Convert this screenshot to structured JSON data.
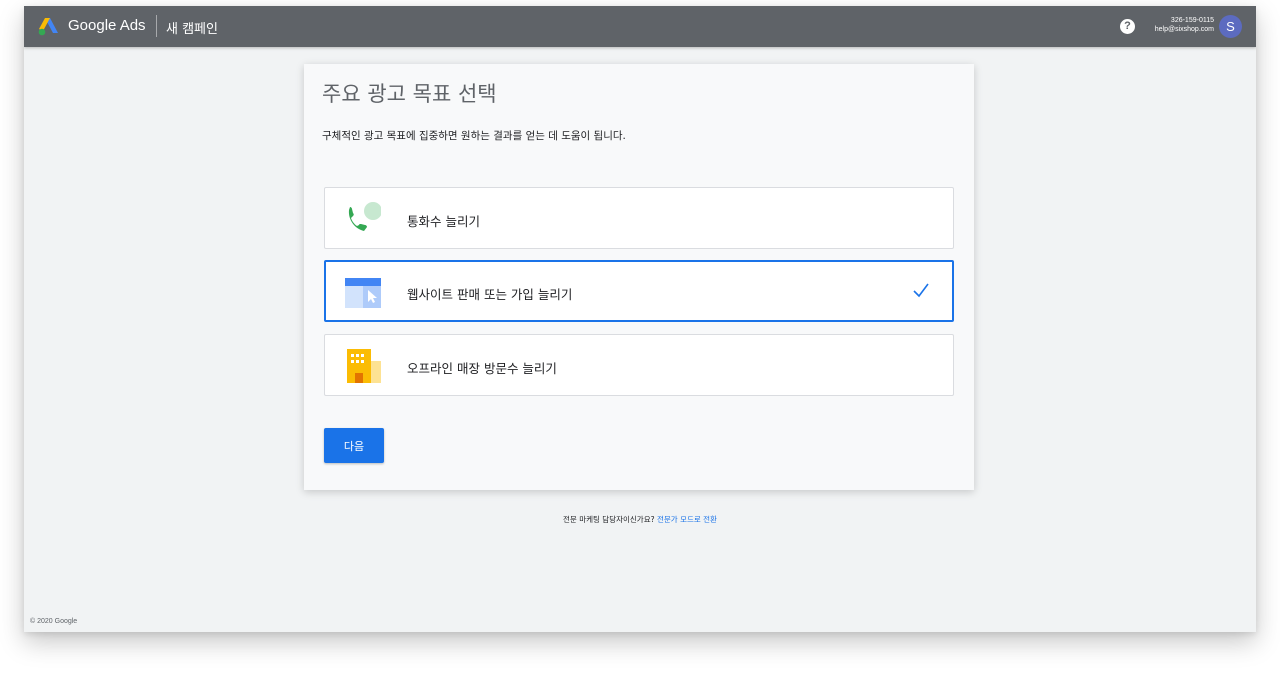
{
  "header": {
    "brand": "Google Ads",
    "campaign_title": "새 캠페인",
    "account_id": "326-159-0115",
    "account_email": "help@sixshop.com",
    "avatar_letter": "S",
    "help_symbol": "?"
  },
  "card": {
    "title": "주요 광고 목표 선택",
    "subtitle": "구체적인 광고 목표에 집중하면 원하는 결과를 얻는 데 도움이 됩니다.",
    "options": [
      {
        "label": "통화수 늘리기",
        "icon": "phone-call-icon",
        "selected": false
      },
      {
        "label": "웹사이트 판매 또는 가입 늘리기",
        "icon": "website-cursor-icon",
        "selected": true
      },
      {
        "label": "오프라인 매장 방문수 늘리기",
        "icon": "store-building-icon",
        "selected": false
      }
    ],
    "next_label": "다음"
  },
  "footer": {
    "question": "전문 마케팅 담당자이신가요?",
    "expert_link": "전문가 모드로 전환",
    "copyright": "© 2020 Google"
  },
  "colors": {
    "topbar": "#5f6368",
    "accent": "#1a73e8",
    "background": "#f1f3f4"
  }
}
